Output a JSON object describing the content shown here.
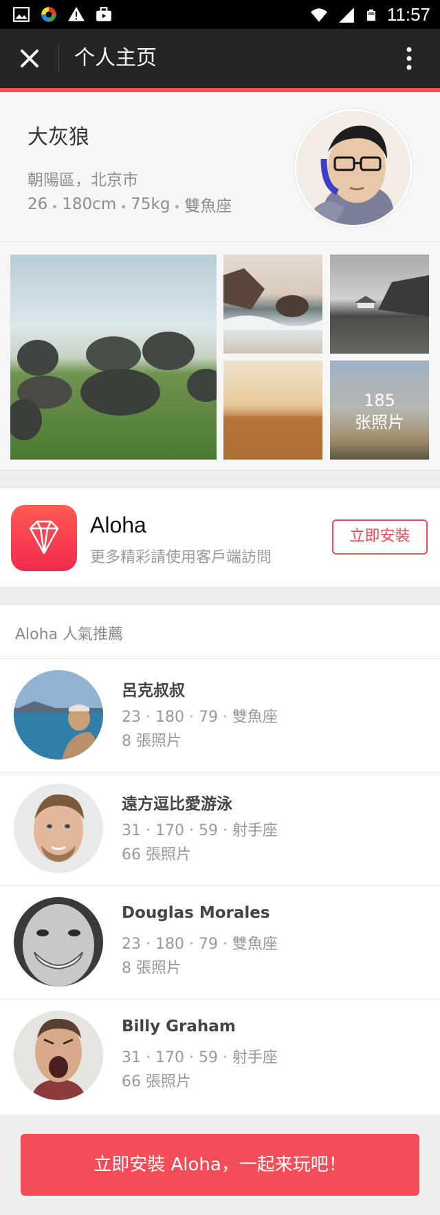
{
  "status_bar": {
    "time": "11:57",
    "icons": [
      "image-icon",
      "colorful-app-icon",
      "warning-icon",
      "briefcase-icon",
      "wifi-icon",
      "cellular-signal-icon",
      "battery-icon"
    ]
  },
  "header": {
    "title": "个人主页",
    "close_icon": "close-icon",
    "more_icon": "more-vertical-icon"
  },
  "profile": {
    "name": "大灰狼",
    "location": "朝陽區，北京市",
    "stats": [
      "26",
      "180cm",
      "75kg",
      "雙魚座"
    ]
  },
  "gallery": {
    "photo_count_number": "185",
    "photo_count_label": "张照片"
  },
  "promo": {
    "app_name": "Aloha",
    "description": "更多精彩請使用客戶端訪問",
    "install_label": "立即安裝"
  },
  "recommendations": {
    "title": "Aloha 人氣推薦",
    "items": [
      {
        "name": "呂克叔叔",
        "stats": "23 · 180 · 79 · 雙魚座",
        "photos": "8 張照片"
      },
      {
        "name": "遠方逗比愛游泳",
        "stats": "31 · 170 · 59 · 射手座",
        "photos": "66 張照片"
      },
      {
        "name": "Douglas Morales",
        "stats": "23 · 180 · 79 · 雙魚座",
        "photos": "8 張照片"
      },
      {
        "name": "Billy Graham",
        "stats": "31 · 170 · 59 · 射手座",
        "photos": "66 張照片"
      }
    ]
  },
  "cta": {
    "label": "立即安裝 Aloha，一起来玩吧！"
  },
  "colors": {
    "accent": "#f44d57",
    "header_bg": "#232527"
  }
}
